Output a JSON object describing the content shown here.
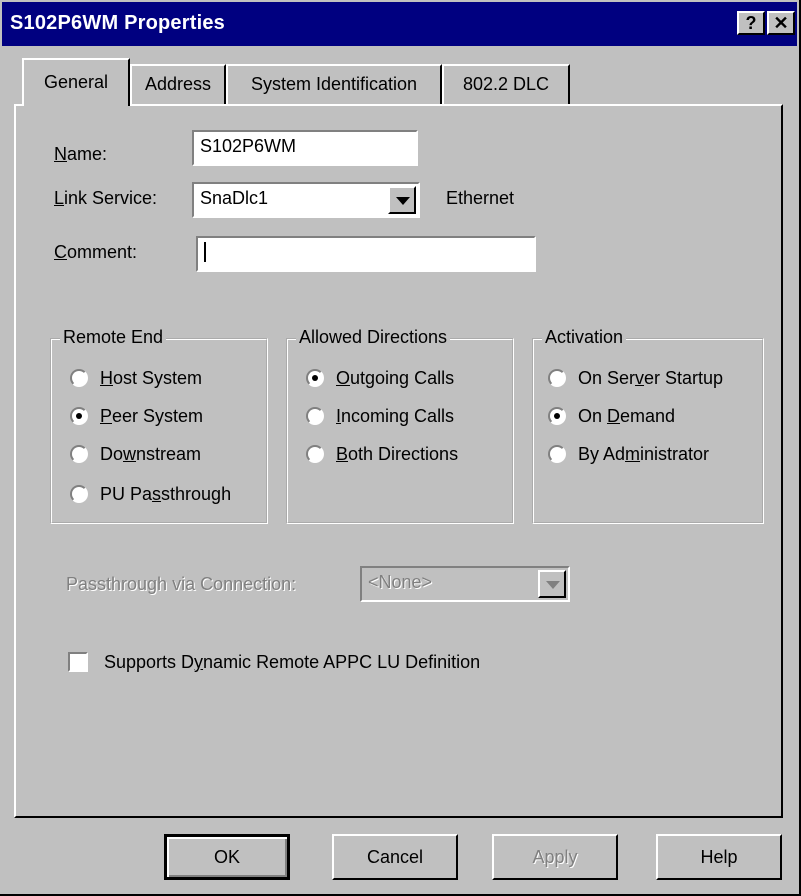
{
  "window": {
    "title": "S102P6WM Properties"
  },
  "titlebar_buttons": {
    "help": "?",
    "close": "✕"
  },
  "tabs": [
    {
      "label": "General",
      "active": true
    },
    {
      "label": "Address",
      "active": false
    },
    {
      "label": "System Identification",
      "active": false
    },
    {
      "label": "802.2 DLC",
      "active": false
    }
  ],
  "general": {
    "name_label": "Name:",
    "name_value": "S102P6WM",
    "link_service_label": "Link Service:",
    "link_service_value": "SnaDlc1",
    "link_service_type": "Ethernet",
    "comment_label": "Comment:",
    "comment_value": ""
  },
  "remote_end": {
    "title": "Remote End",
    "options": [
      {
        "label": "Host System",
        "selected": false
      },
      {
        "label": "Peer System",
        "selected": true
      },
      {
        "label": "Downstream",
        "selected": false
      },
      {
        "label": "PU Passthrough",
        "selected": false
      }
    ]
  },
  "allowed_directions": {
    "title": "Allowed Directions",
    "options": [
      {
        "label": "Outgoing Calls",
        "selected": true
      },
      {
        "label": "Incoming Calls",
        "selected": false
      },
      {
        "label": "Both Directions",
        "selected": false
      }
    ]
  },
  "activation": {
    "title": "Activation",
    "options": [
      {
        "label": "On Server Startup",
        "selected": false
      },
      {
        "label": "On Demand",
        "selected": true
      },
      {
        "label": "By Administrator",
        "selected": false
      }
    ]
  },
  "passthrough": {
    "label": "Passthrough via Connection:",
    "value": "<None>",
    "disabled": true
  },
  "dynamic_lu": {
    "label": "Supports Dynamic Remote APPC LU Definition",
    "checked": false
  },
  "buttons": {
    "ok": "OK",
    "cancel": "Cancel",
    "apply": "Apply",
    "help": "Help"
  },
  "colors": {
    "titlebar": "#000080",
    "face": "#c0c0c0",
    "disabled_text": "#808080"
  }
}
